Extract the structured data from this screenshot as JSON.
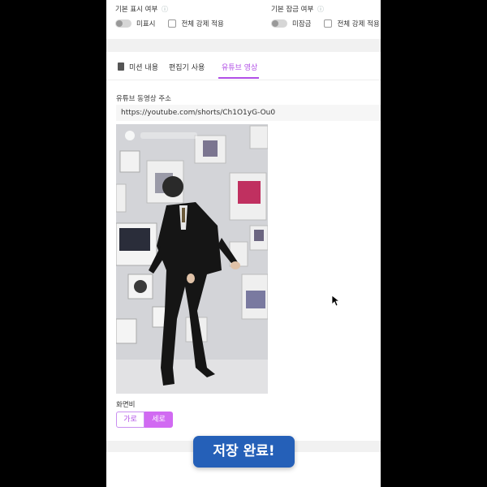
{
  "settings": {
    "display": {
      "title": "기본 표시 여부",
      "toggle_label": "미표시",
      "checkbox_label": "전체 강제 적용"
    },
    "lock": {
      "title": "기본 잠금 여부",
      "toggle_label": "미잠금",
      "checkbox_label": "전체 강제 적용"
    }
  },
  "tabs": [
    {
      "label": "미션 내용",
      "icon": "clipboard-icon"
    },
    {
      "label": "편집기 사용"
    },
    {
      "label": "유튜브 영상",
      "active": true
    }
  ],
  "video": {
    "url_label": "유튜브 동영상 주소",
    "url_value": "https://youtube.com/shorts/Ch1O1yG-Ou0"
  },
  "ratio": {
    "label": "화면비",
    "options": [
      "가로",
      "세로"
    ],
    "selected": "세로"
  },
  "toast": {
    "message": "저장 완료!"
  },
  "colors": {
    "accent": "#b14fe6",
    "toast_bg": "#2560b8"
  }
}
